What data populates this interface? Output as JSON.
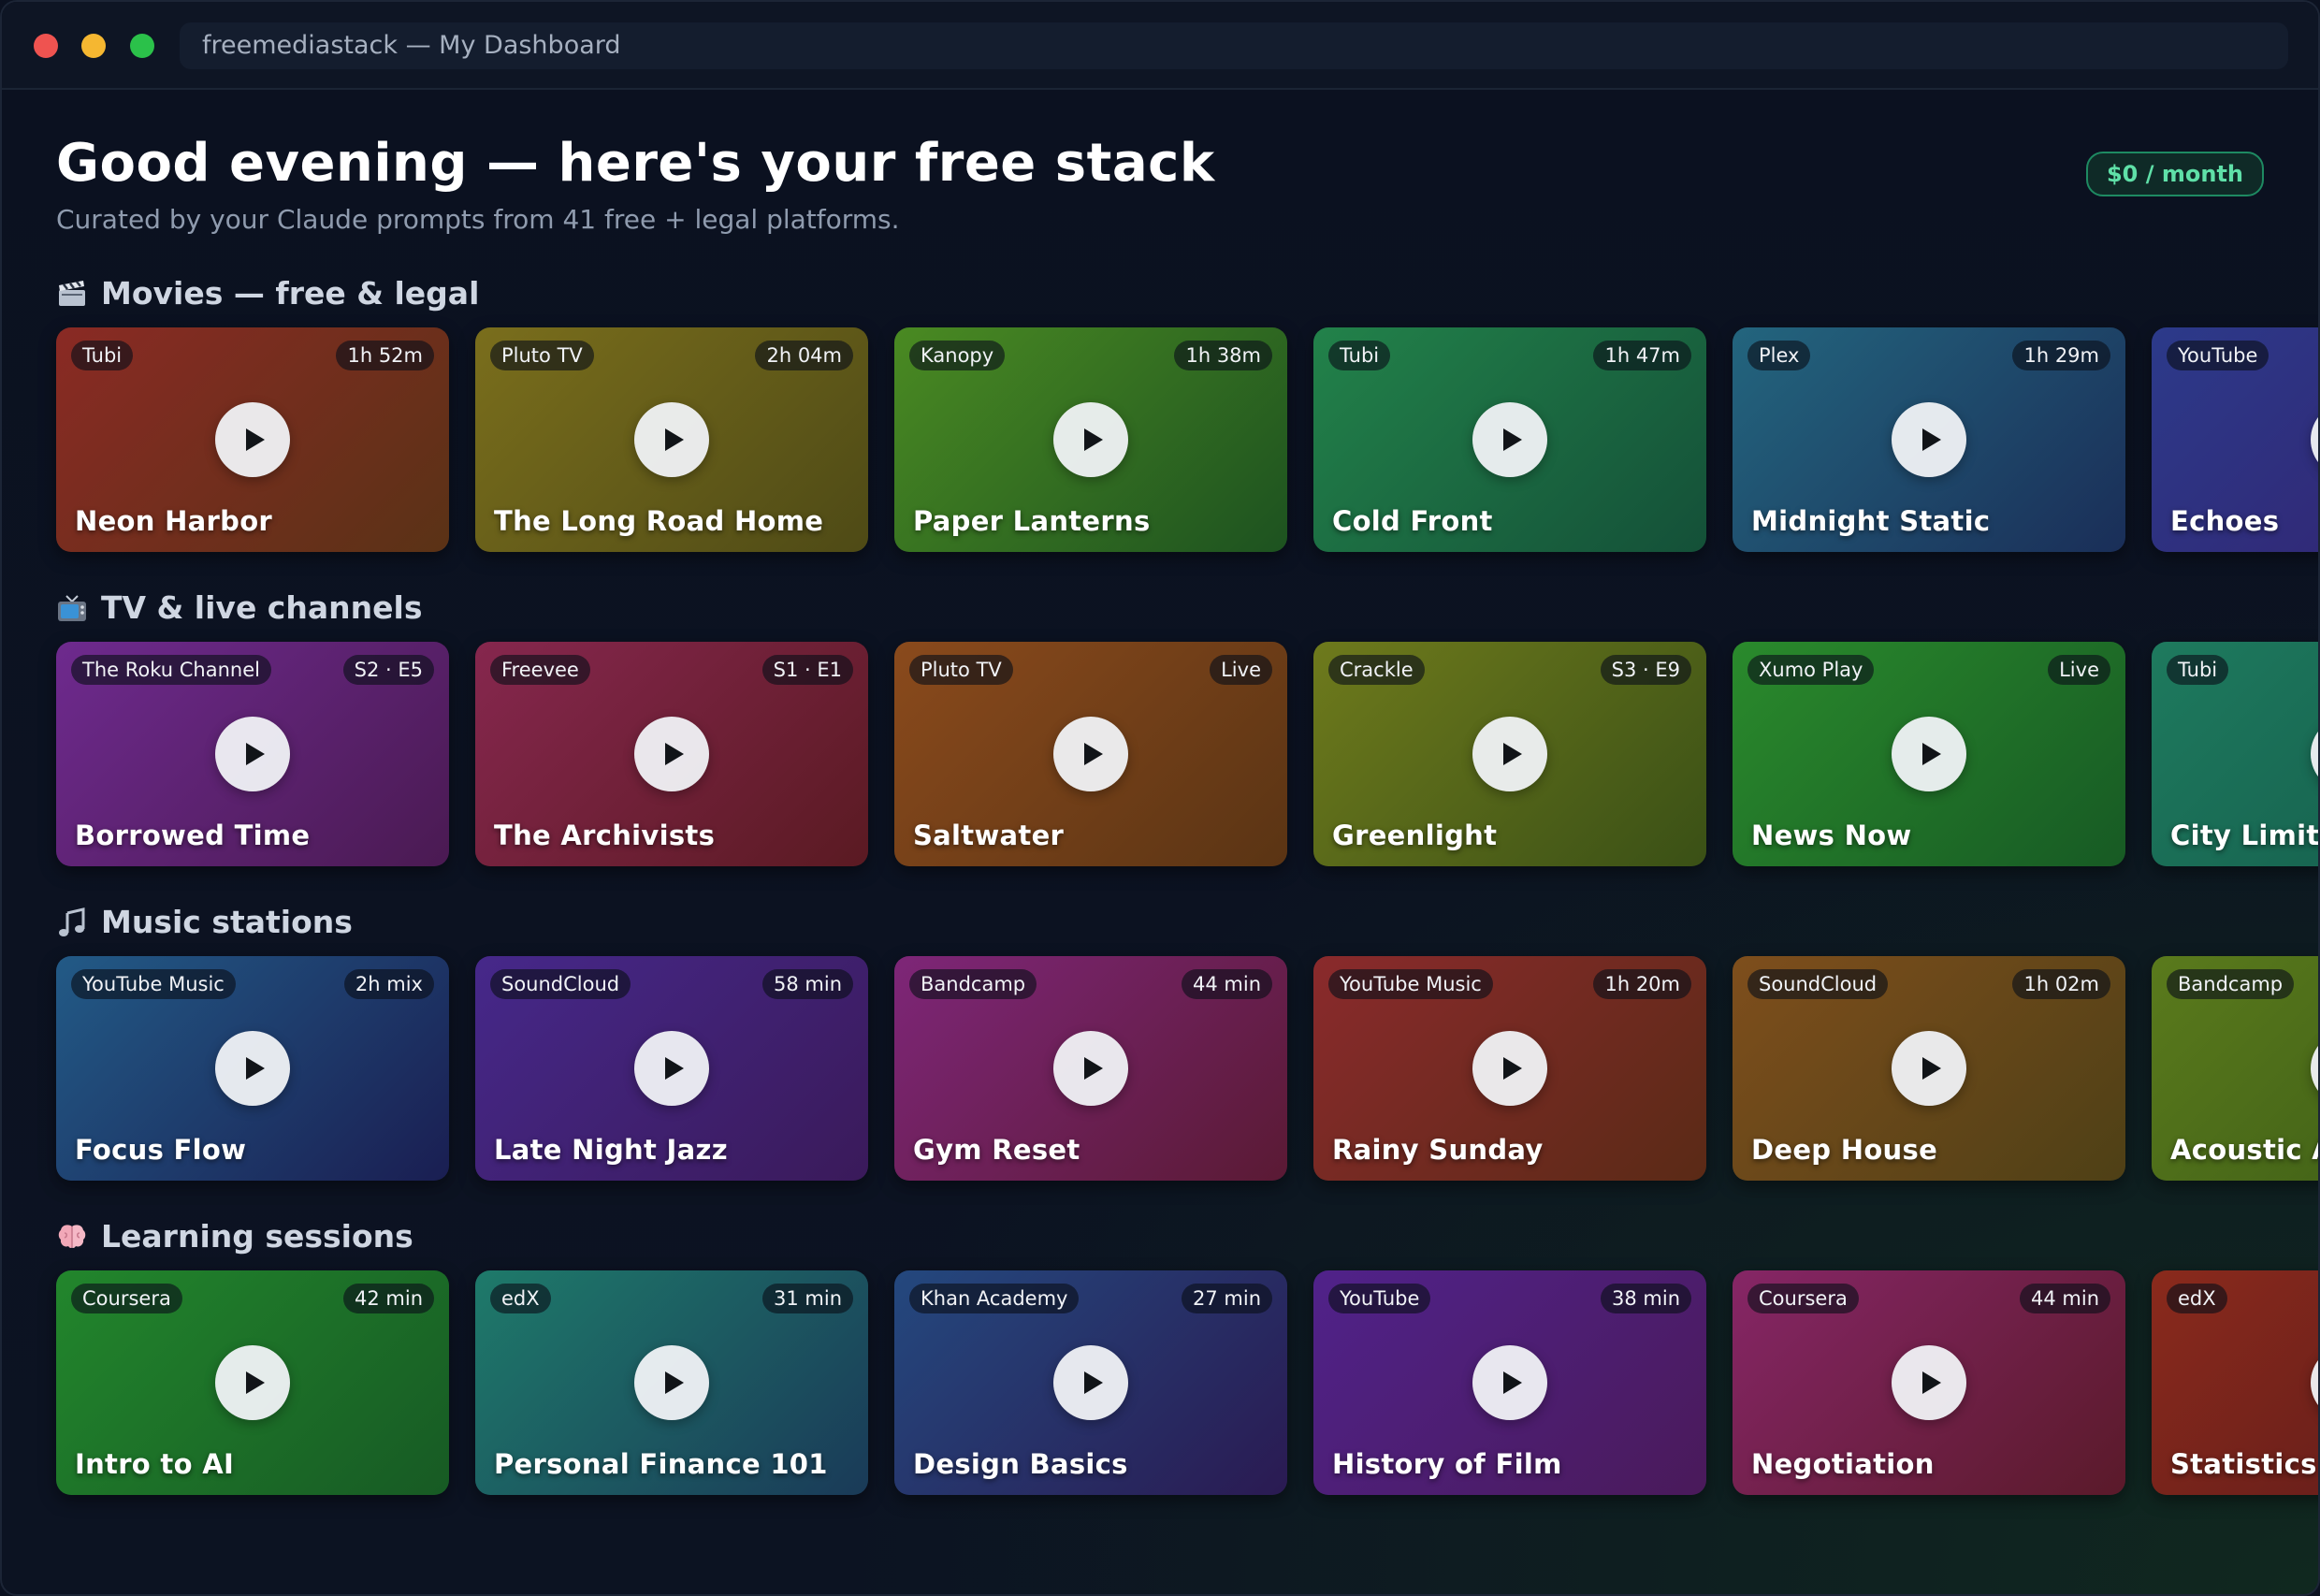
{
  "window": {
    "address": "freemediastack — My Dashboard"
  },
  "header": {
    "greeting": "Good evening — here's your free stack",
    "subtitle": "Curated by your Claude prompts from 41 free + legal platforms.",
    "price_badge": "$0 / month"
  },
  "colors": {
    "background": "#0b1120",
    "badge_accent": "#5fe0a8"
  },
  "sections": [
    {
      "title": "Movies — free & legal",
      "icon": "clapperboard-icon",
      "cards": [
        {
          "platform": "Tubi",
          "duration": "1h 52m",
          "title": "Neon Harbor",
          "c1": "#8a2a24",
          "c2": "#5a3216"
        },
        {
          "platform": "Pluto TV",
          "duration": "2h 04m",
          "title": "The Long Road Home",
          "c1": "#7a6e1c",
          "c2": "#4e4a16"
        },
        {
          "platform": "Kanopy",
          "duration": "1h 38m",
          "title": "Paper Lanterns",
          "c1": "#4a8a22",
          "c2": "#1d5220"
        },
        {
          "platform": "Tubi",
          "duration": "1h 47m",
          "title": "Cold Front",
          "c1": "#22824a",
          "c2": "#145038"
        },
        {
          "platform": "Plex",
          "duration": "1h 29m",
          "title": "Midnight Static",
          "c1": "#23657e",
          "c2": "#1a2e58"
        },
        {
          "platform": "YouTube",
          "duration": "",
          "title": "Echoes",
          "c1": "#2c3a8a",
          "c2": "#33216e"
        }
      ]
    },
    {
      "title": "TV & live channels",
      "icon": "tv-icon",
      "cards": [
        {
          "platform": "The Roku Channel",
          "duration": "S2 · E5",
          "title": "Borrowed Time",
          "c1": "#6e2a8e",
          "c2": "#4a1a52"
        },
        {
          "platform": "Freevee",
          "duration": "S1 · E1",
          "title": "The Archivists",
          "c1": "#86274e",
          "c2": "#5a1a22"
        },
        {
          "platform": "Pluto TV",
          "duration": "Live",
          "title": "Saltwater",
          "c1": "#8a4a1c",
          "c2": "#5a3414"
        },
        {
          "platform": "Crackle",
          "duration": "S3 · E9",
          "title": "Greenlight",
          "c1": "#6e7a1c",
          "c2": "#3a5016"
        },
        {
          "platform": "Xumo Play",
          "duration": "Live",
          "title": "News Now",
          "c1": "#2a8a2c",
          "c2": "#175a24"
        },
        {
          "platform": "Tubi",
          "duration": "",
          "title": "City Limits",
          "c1": "#1e7a5e",
          "c2": "#145a4a"
        }
      ]
    },
    {
      "title": "Music stations",
      "icon": "music-note-icon",
      "cards": [
        {
          "platform": "YouTube Music",
          "duration": "2h mix",
          "title": "Focus Flow",
          "c1": "#225a86",
          "c2": "#1a1e52"
        },
        {
          "platform": "SoundCloud",
          "duration": "58 min",
          "title": "Late Night Jazz",
          "c1": "#46288a",
          "c2": "#3a1a5a"
        },
        {
          "platform": "Bandcamp",
          "duration": "44 min",
          "title": "Gym Reset",
          "c1": "#7e2678",
          "c2": "#5a1a34"
        },
        {
          "platform": "YouTube Music",
          "duration": "1h 20m",
          "title": "Rainy Sunday",
          "c1": "#8a2a2c",
          "c2": "#5a2a16"
        },
        {
          "platform": "SoundCloud",
          "duration": "1h 02m",
          "title": "Deep House",
          "c1": "#7e4e1c",
          "c2": "#4e4016"
        },
        {
          "platform": "Bandcamp",
          "duration": "",
          "title": "Acoustic Al",
          "c1": "#5a7a1c",
          "c2": "#3a5a16"
        }
      ]
    },
    {
      "title": "Learning sessions",
      "icon": "brain-icon",
      "cards": [
        {
          "platform": "Coursera",
          "duration": "42 min",
          "title": "Intro to AI",
          "c1": "#22862c",
          "c2": "#175a24"
        },
        {
          "platform": "edX",
          "duration": "31 min",
          "title": "Personal Finance 101",
          "c1": "#1e7a6a",
          "c2": "#1a3a58"
        },
        {
          "platform": "Khan Academy",
          "duration": "27 min",
          "title": "Design Basics",
          "c1": "#24487e",
          "c2": "#2a1a52"
        },
        {
          "platform": "YouTube",
          "duration": "38 min",
          "title": "History of Film",
          "c1": "#50228a",
          "c2": "#4a1a5a"
        },
        {
          "platform": "Coursera",
          "duration": "44 min",
          "title": "Negotiation",
          "c1": "#862666",
          "c2": "#5a1a2a"
        },
        {
          "platform": "edX",
          "duration": "",
          "title": "Statistics",
          "c1": "#8a2a1c",
          "c2": "#5a1a1a"
        }
      ]
    }
  ]
}
